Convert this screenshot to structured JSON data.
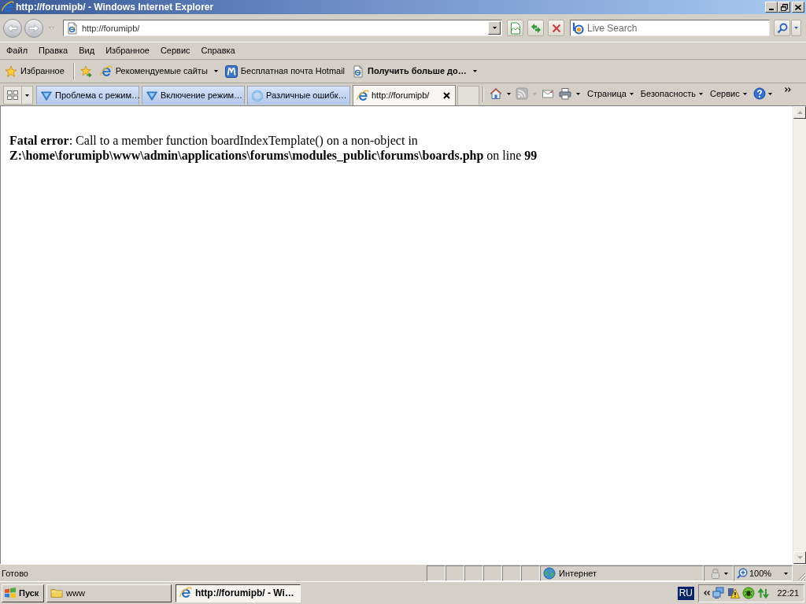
{
  "window": {
    "title": "http://forumipb/ - Windows Internet Explorer"
  },
  "address_bar": {
    "value": "http://forumipb/"
  },
  "search_box": {
    "placeholder": "Live Search"
  },
  "menu_bar": {
    "items": [
      "Файл",
      "Правка",
      "Вид",
      "Избранное",
      "Сервис",
      "Справка"
    ]
  },
  "favorites_bar": {
    "favorites_button": "Избранное",
    "links": [
      {
        "kind": "ie",
        "label": "Рекомендуемые сайты",
        "dropdown": true,
        "bold": false
      },
      {
        "kind": "mail",
        "label": "Бесплатная почта Hotmail",
        "dropdown": false,
        "bold": false
      },
      {
        "kind": "page",
        "label": "Получить больше до…",
        "dropdown": true,
        "bold": true
      }
    ]
  },
  "tabs": [
    {
      "kind": "site",
      "label": "Проблема с режим…",
      "selected": false
    },
    {
      "kind": "site",
      "label": "Включение режим…",
      "selected": false
    },
    {
      "kind": "loading",
      "label": "Различные ошибк…",
      "selected": false
    },
    {
      "kind": "page",
      "label": "http://forumipb/",
      "selected": true
    }
  ],
  "command_bar": {
    "tools": [
      {
        "kind": "home",
        "dropdown": true,
        "disabled": false
      },
      {
        "kind": "feeds",
        "dropdown": true,
        "disabled": true
      },
      {
        "kind": "mail",
        "dropdown": false,
        "disabled": false
      },
      {
        "kind": "print",
        "dropdown": true,
        "disabled": false
      }
    ],
    "menus": [
      "Страница",
      "Безопасность",
      "Сервис"
    ]
  },
  "page": {
    "error": "**Fatal error**: Call to a member function boardIndexTemplate() on a non-object in **Z:\\home\\forumipb\\www\\admin\\applications\\forums\\modules_public\\forums\\boards.php** on line **99**"
  },
  "status_bar": {
    "text": "Готово",
    "zone": "Интернет",
    "zoom": "100%"
  },
  "taskbar": {
    "start": "Пуск",
    "windows": [
      {
        "kind": "folder",
        "label": "www",
        "selected": false
      },
      {
        "kind": "ie",
        "label": "http://forumipb/ - Wi…",
        "selected": true
      }
    ],
    "language": "RU",
    "time": "22:21"
  }
}
